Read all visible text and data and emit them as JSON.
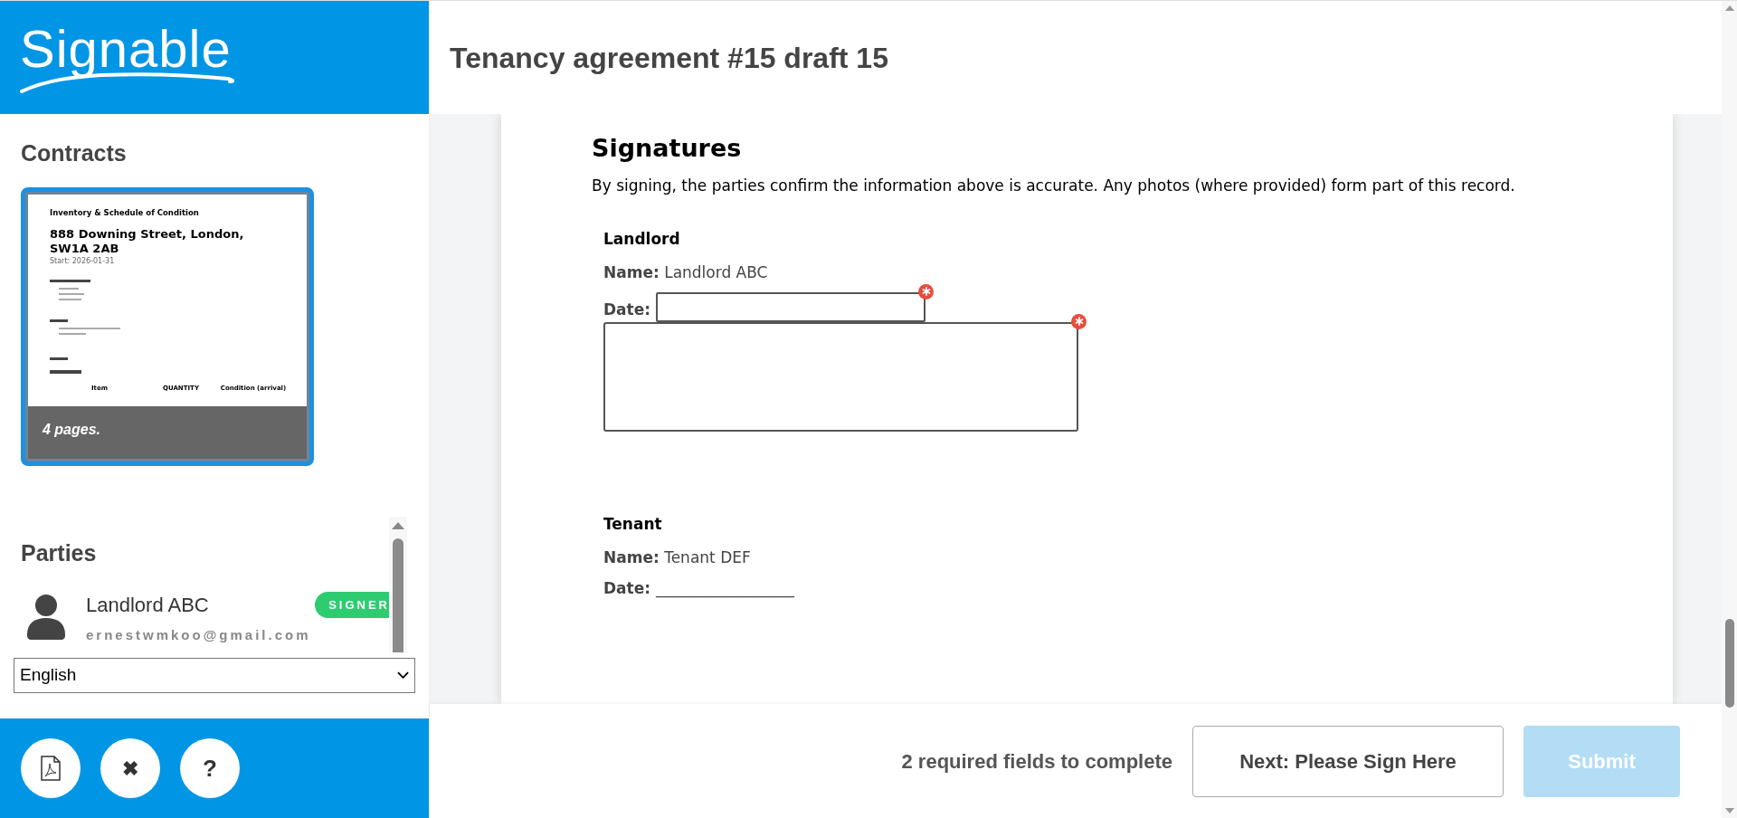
{
  "logo": {
    "text": "Signable"
  },
  "header": {
    "title": "Tenancy agreement #15 draft 15"
  },
  "sidebar": {
    "contracts_title": "Contracts",
    "contracts": [
      {
        "selected": true,
        "pages": "4 pages.",
        "preview": {
          "heading": "Inventory & Schedule of Condition",
          "address": "888 Downing Street, London, SW1A 2AB",
          "start": "Start: 2026-01-31",
          "columns": [
            "Item",
            "QUANTITY",
            "Condition (arrival)"
          ]
        }
      }
    ],
    "parties_title": "Parties",
    "parties": [
      {
        "name": "Landlord ABC",
        "email": "ernestwmkoo@gmail.com",
        "role": "SIGNER"
      }
    ],
    "language": "English",
    "footer_buttons": [
      {
        "kind": "pdf"
      },
      {
        "kind": "close",
        "label": "✖"
      },
      {
        "kind": "help",
        "label": "?"
      }
    ]
  },
  "document": {
    "heading": "Signatures",
    "intro": "By signing, the parties confirm the information above is accurate. Any photos (where provided) form part of this record.",
    "blocks": [
      {
        "role": "Landlord",
        "name_label": "Name:",
        "name": "Landlord ABC",
        "date_label": "Date:",
        "date_required": true,
        "signature_box": true,
        "signature_required": true
      },
      {
        "role": "Tenant",
        "name_label": "Name:",
        "name": "Tenant DEF",
        "date_label": "Date:",
        "date_line": "__________________"
      }
    ]
  },
  "footer": {
    "status": "2 required fields to complete",
    "next": "Next: Please Sign Here",
    "submit": {
      "label": "Submit",
      "disabled": true
    }
  }
}
